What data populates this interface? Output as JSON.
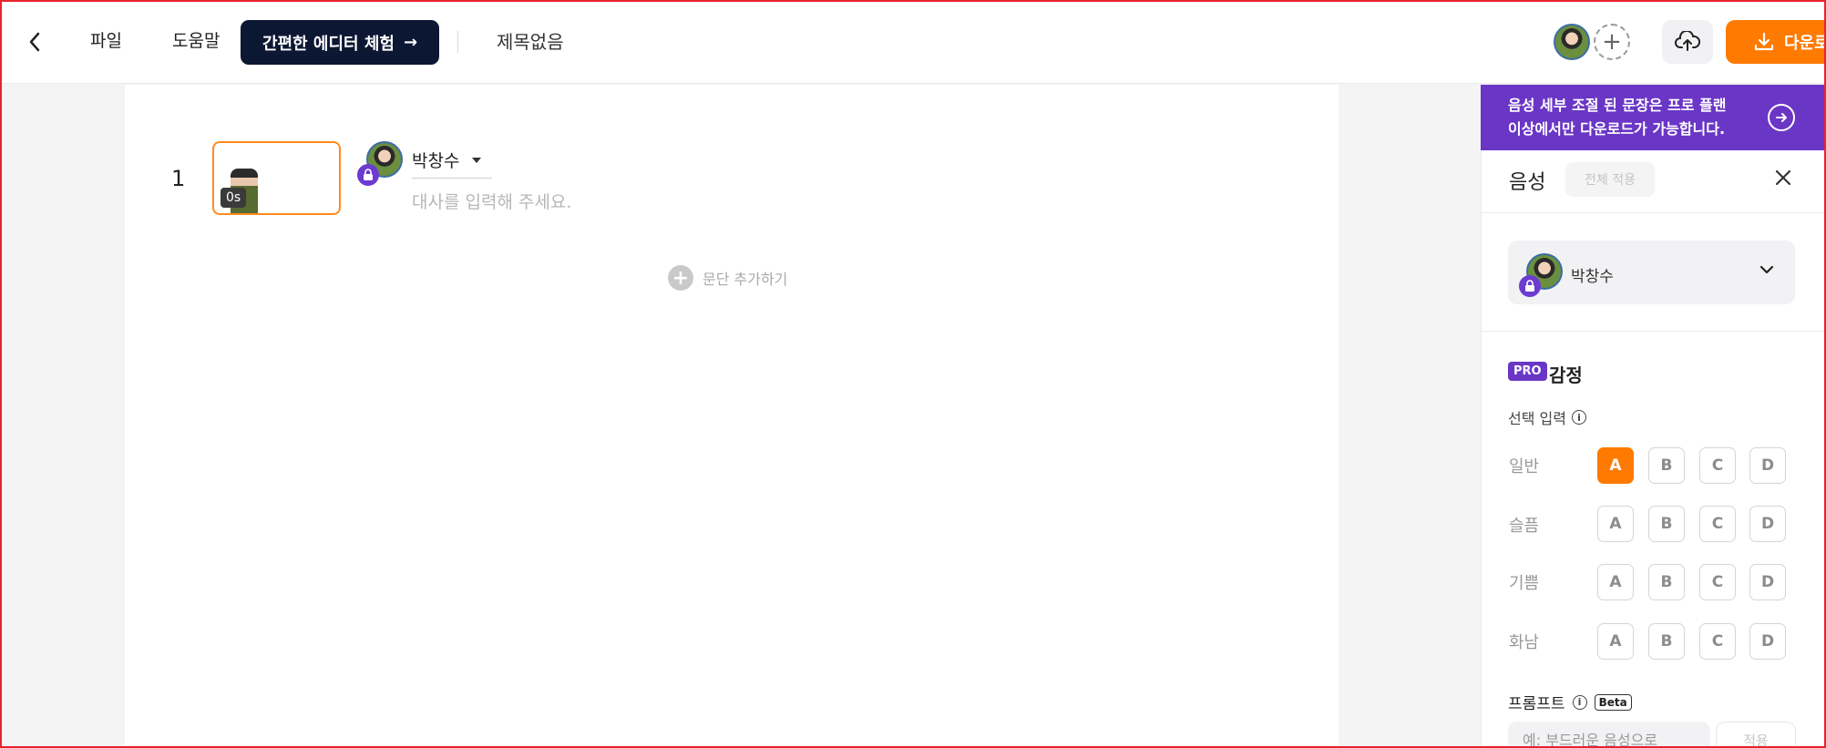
{
  "topbar": {
    "menu_file": "파일",
    "menu_help": "도움말",
    "trial_button": "간편한 에디터 체험",
    "trial_arrow": "→",
    "doc_title": "제목없음",
    "add_user": "+",
    "download_label": "다운로드"
  },
  "editor": {
    "paragraphs": [
      {
        "number": "1",
        "time": "0s",
        "speaker": "박창수",
        "placeholder": "대사를 입력해 주세요."
      }
    ],
    "add_paragraph": "문단 추가하기"
  },
  "panel": {
    "banner_text_line1": "음성 세부 조절 된 문장은 프로 플랜",
    "banner_text_line2": "이상에서만 다운로드가 가능합니다.",
    "title": "음성",
    "apply_all": "전체 적용",
    "voice_name": "박창수",
    "pro_badge": "PRO",
    "emotion_title": "감정",
    "select_input_label": "선택 입력",
    "emotions": [
      {
        "label": "일반",
        "options": [
          "A",
          "B",
          "C",
          "D"
        ],
        "selected": "A"
      },
      {
        "label": "슬픔",
        "options": [
          "A",
          "B",
          "C",
          "D"
        ],
        "selected": null
      },
      {
        "label": "기쁨",
        "options": [
          "A",
          "B",
          "C",
          "D"
        ],
        "selected": null
      },
      {
        "label": "화남",
        "options": [
          "A",
          "B",
          "C",
          "D"
        ],
        "selected": null
      }
    ],
    "prompt_label": "프롬프트",
    "beta_badge": "Beta",
    "prompt_placeholder": "예: 부드러운 음성으로",
    "prompt_apply": "적용"
  },
  "colors": {
    "accent_orange": "#ff7a00",
    "pro_purple": "#6a36c6",
    "navy": "#0c1733"
  }
}
